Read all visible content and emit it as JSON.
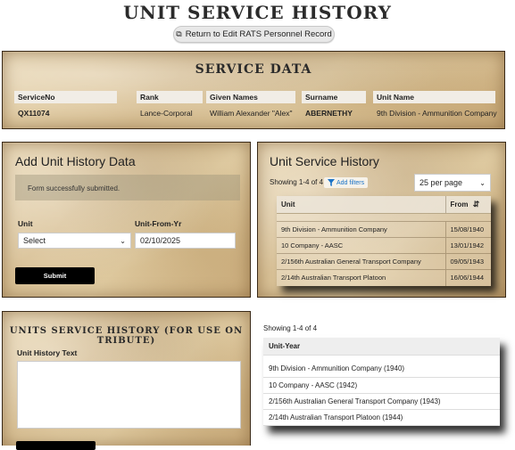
{
  "page": {
    "title": "UNIT SERVICE HISTORY",
    "return_button": {
      "label": "Return to Edit RATS Personnel Record",
      "icon": "copy-icon"
    }
  },
  "service_data": {
    "title": "SERVICE DATA",
    "columns": [
      "ServiceNo",
      "Rank",
      "Given Names",
      "Surname",
      "Unit Name"
    ],
    "values": [
      "QX11074",
      "Lance-Corporal",
      "William Alexander \"Alex\"",
      "ABERNETHY",
      "9th Division - Ammunition Company"
    ]
  },
  "add_unit_history": {
    "title": "Add Unit History Data",
    "success_message": "Form successfully submitted.",
    "unit_label": "Unit",
    "unit_value": "Select",
    "unit_from_label": "Unit-From-Yr",
    "unit_from_value": "02/10/2025",
    "submit_label": "Submit"
  },
  "unit_service_history": {
    "title": "Unit Service History",
    "showing": "Showing 1-4 of 4",
    "add_filters": "Add filters",
    "per_page": "25 per page",
    "columns": [
      "Unit",
      "From"
    ],
    "rows": [
      {
        "unit": "9th Division - Ammunition Company",
        "from": "15/08/1940"
      },
      {
        "unit": "10 Company - AASC",
        "from": "13/01/1942"
      },
      {
        "unit": "2/156th Australian General Transport Company",
        "from": "09/05/1943"
      },
      {
        "unit": "2/14th Australian Transport Platoon",
        "from": "16/06/1944"
      }
    ]
  },
  "tribute": {
    "title": "UNITS SERVICE HISTORY (FOR USE ON TRIBUTE)",
    "text_label": "Unit History Text",
    "text_value": ""
  },
  "tribute_list": {
    "showing": "Showing 1-4 of 4",
    "column": "Unit-Year",
    "rows": [
      "9th Division - Ammunition Company (1940)",
      "10 Company - AASC (1942)",
      "2/156th Australian General Transport Company (1943)",
      "2/14th Australian Transport Platoon (1944)"
    ]
  }
}
